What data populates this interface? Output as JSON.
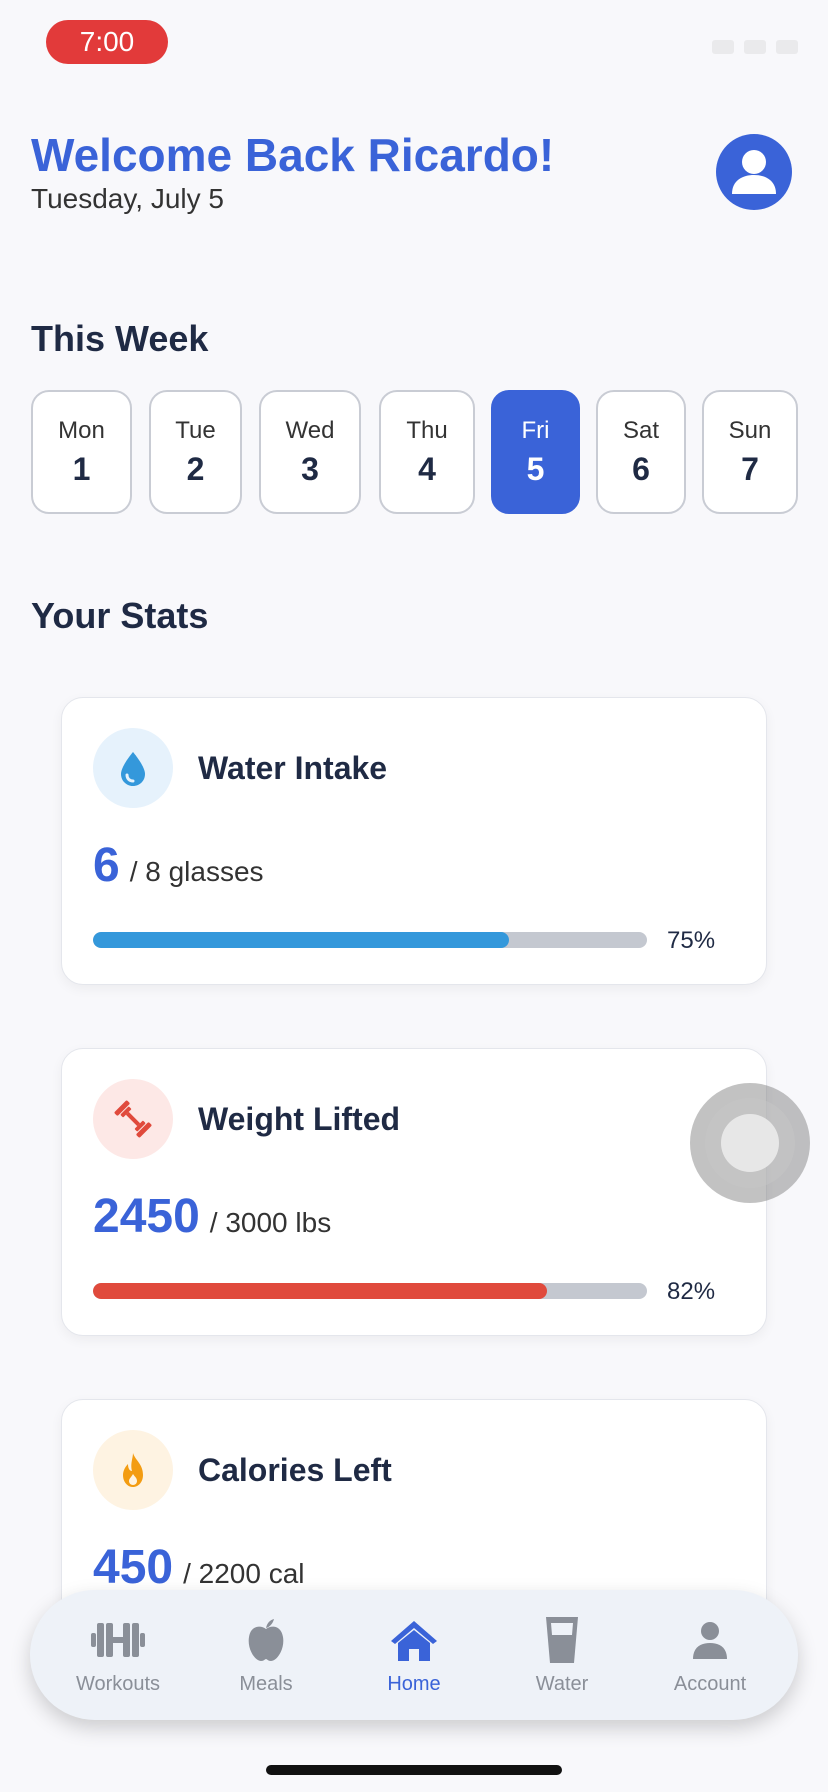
{
  "status_bar": {
    "time": "7:00"
  },
  "header": {
    "welcome": "Welcome Back Ricardo!",
    "date": "Tuesday, July 5"
  },
  "week": {
    "title": "This Week",
    "days": [
      {
        "name": "Mon",
        "num": "1",
        "active": false
      },
      {
        "name": "Tue",
        "num": "2",
        "active": false
      },
      {
        "name": "Wed",
        "num": "3",
        "active": false
      },
      {
        "name": "Thu",
        "num": "4",
        "active": false
      },
      {
        "name": "Fri",
        "num": "5",
        "active": true
      },
      {
        "name": "Sat",
        "num": "6",
        "active": false
      },
      {
        "name": "Sun",
        "num": "7",
        "active": false
      }
    ]
  },
  "stats": {
    "title": "Your Stats",
    "cards": [
      {
        "title": "Water Intake",
        "value": "6",
        "unit": "/ 8 glasses",
        "percent_label": "75%",
        "progress": 0.75,
        "icon": "water-drop-icon",
        "color": "#3498db",
        "icon_bg": "#e6f2fc"
      },
      {
        "title": "Weight Lifted",
        "value": "2450",
        "unit": "/ 3000 lbs",
        "percent_label": "82%",
        "progress": 0.82,
        "icon": "dumbbell-icon",
        "color": "#e04a3c",
        "icon_bg": "#fde8e6"
      },
      {
        "title": "Calories Left",
        "value": "450",
        "unit": "/ 2200 cal",
        "percent_label": "",
        "progress": null,
        "icon": "flame-icon",
        "color": "#f39c12",
        "icon_bg": "#fef3e2"
      }
    ]
  },
  "nav": {
    "items": [
      {
        "label": "Workouts",
        "icon": "dumbbell-icon",
        "active": false
      },
      {
        "label": "Meals",
        "icon": "apple-icon",
        "active": false
      },
      {
        "label": "Home",
        "icon": "home-icon",
        "active": true
      },
      {
        "label": "Water",
        "icon": "glass-icon",
        "active": false
      },
      {
        "label": "Account",
        "icon": "person-icon",
        "active": false
      }
    ]
  },
  "colors": {
    "accent": "#3a63d8",
    "inactive": "#8a8f98"
  }
}
